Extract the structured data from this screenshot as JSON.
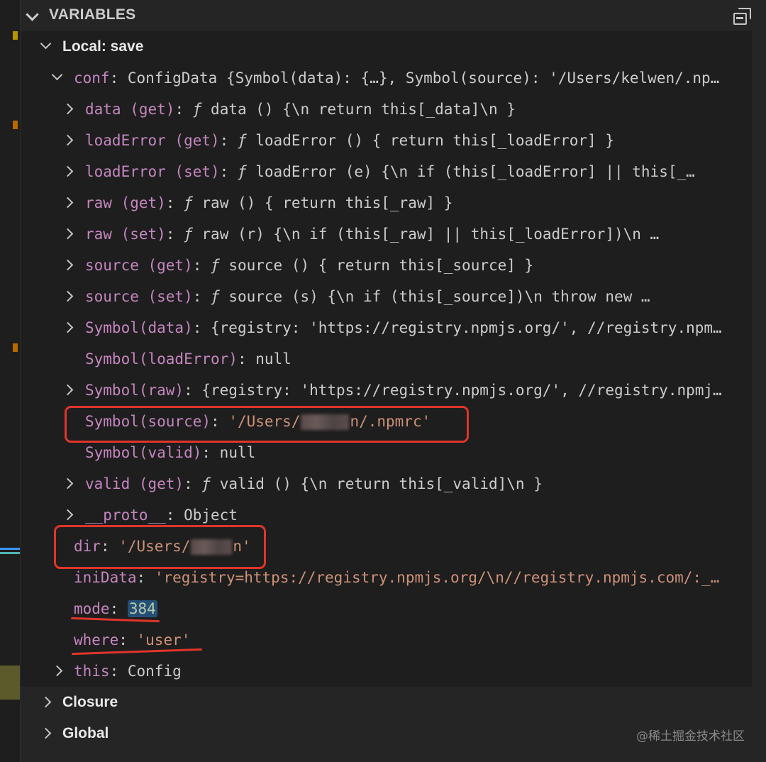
{
  "panel": {
    "title": "VARIABLES",
    "collapse_icon": "collapse-all-icon"
  },
  "scope": {
    "local_label": "Local: save",
    "closure_label": "Closure",
    "global_label": "Global"
  },
  "conf": {
    "name": "conf",
    "value": "ConfigData {Symbol(data): {…}, Symbol(source): '/Users/kelwen/.np…"
  },
  "children": [
    {
      "name": "data (get)",
      "kind": "ƒ",
      "value": "data () {\\n    return this[_data]\\n  }",
      "expandable": true
    },
    {
      "name": "loadError (get)",
      "kind": "ƒ",
      "value": "loadError () { return this[_loadError] }",
      "expandable": true
    },
    {
      "name": "loadError (set)",
      "kind": "ƒ",
      "value": "loadError (e) {\\n    if (this[_loadError] || this[_…",
      "expandable": true
    },
    {
      "name": "raw (get)",
      "kind": "ƒ",
      "value": "raw () { return this[_raw] }",
      "expandable": true
    },
    {
      "name": "raw (set)",
      "kind": "ƒ",
      "value": "raw (r) {\\n    if (this[_raw] || this[_loadError])\\n     …",
      "expandable": true
    },
    {
      "name": "source (get)",
      "kind": "ƒ",
      "value": "source () { return this[_source] }",
      "expandable": true
    },
    {
      "name": "source (set)",
      "kind": "ƒ",
      "value": "source (s) {\\n    if (this[_source])\\n      throw new …",
      "expandable": true
    },
    {
      "name": "Symbol(data)",
      "kind": "",
      "value": "{registry: 'https://registry.npmjs.org/', //registry.npm…",
      "expandable": true
    },
    {
      "name": "Symbol(loadError)",
      "kind": "",
      "value": "null",
      "expandable": false
    },
    {
      "name": "Symbol(raw)",
      "kind": "",
      "value": "{registry: 'https://registry.npmjs.org/', //registry.npmj…",
      "expandable": true
    },
    {
      "name": "Symbol(source)",
      "kind": "",
      "value_prefix": "'/Users/",
      "value_suffix": "n/.npmrc'",
      "expandable": false
    },
    {
      "name": "Symbol(valid)",
      "kind": "",
      "value": "null",
      "expandable": false
    },
    {
      "name": "valid (get)",
      "kind": "ƒ",
      "value": "valid () {\\n    return this[_valid]\\n  }",
      "expandable": true
    },
    {
      "name": "__proto__",
      "kind": "",
      "value": "Object",
      "expandable": true
    }
  ],
  "props": [
    {
      "name": "dir",
      "value_prefix": "'/Users/",
      "value_suffix": "n'"
    },
    {
      "name": "iniData",
      "value": "'registry=https://registry.npmjs.org/\\n//registry.npmjs.com/:_…"
    },
    {
      "name": "mode",
      "value": "384"
    },
    {
      "name": "where",
      "value": "'user'"
    }
  ],
  "this_row": {
    "name": "this",
    "value": "Config"
  },
  "watermark": "@稀土掘金技术社区",
  "colors": {
    "accent_red": "#e0352b",
    "property_name": "#c586c0",
    "string_value": "#ce9178",
    "number_value": "#b5cea8"
  }
}
